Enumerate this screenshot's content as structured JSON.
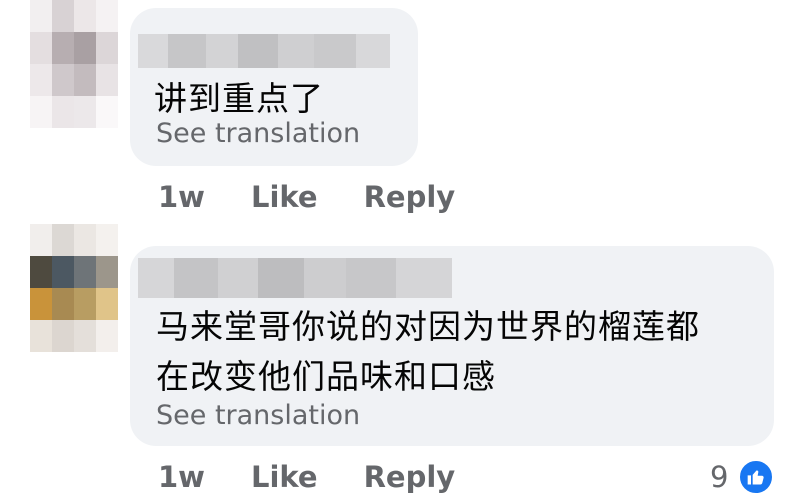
{
  "comments": [
    {
      "author": "",
      "lines": [
        "讲到重点了"
      ],
      "see_translation": "See translation",
      "time": "1w",
      "like": "Like",
      "reply": "Reply"
    },
    {
      "author": "",
      "lines": [
        "马来堂哥你说的对因为世界的榴莲都",
        "在改变他们品味和口感"
      ],
      "see_translation": "See translation",
      "time": "1w",
      "like": "Like",
      "reply": "Reply",
      "reaction_count": "9",
      "reaction_icon": "thumbs-up-icon"
    }
  ],
  "colors": {
    "bubble": "#f0f2f5",
    "meta": "#65676b",
    "like_blue": "#1877f2"
  }
}
